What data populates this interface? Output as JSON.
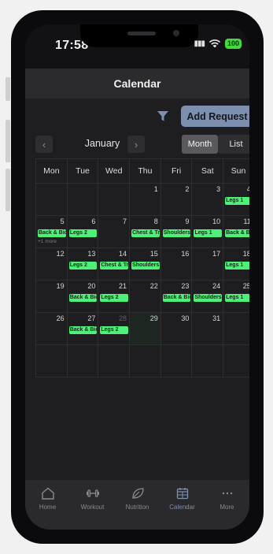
{
  "status": {
    "time": "17:58",
    "battery": "100"
  },
  "header": {
    "title": "Calendar"
  },
  "toolbar": {
    "add_request_label": "Add Request"
  },
  "calendar_nav": {
    "month": "January",
    "prev_icon": "chevron-left-icon",
    "next_icon": "chevron-right-icon"
  },
  "view_toggle": {
    "month_label": "Month",
    "list_label": "List",
    "selected": "Month"
  },
  "weekdays": [
    "Mon",
    "Tue",
    "Wed",
    "Thu",
    "Fri",
    "Sat",
    "Sun"
  ],
  "weeks": [
    [
      {
        "day": ""
      },
      {
        "day": ""
      },
      {
        "day": ""
      },
      {
        "day": "1"
      },
      {
        "day": "2"
      },
      {
        "day": "3"
      },
      {
        "day": "4",
        "events": [
          "Legs 1"
        ]
      }
    ],
    [
      {
        "day": "5",
        "events": [
          "Back & Biceps"
        ],
        "more": "+1 more"
      },
      {
        "day": "6",
        "events": [
          "Legs 2"
        ]
      },
      {
        "day": "7"
      },
      {
        "day": "8",
        "events": [
          "Chest & Triceps"
        ]
      },
      {
        "day": "9",
        "events": [
          "Shoulders"
        ]
      },
      {
        "day": "10",
        "events": [
          "Legs 1"
        ]
      },
      {
        "day": "11",
        "events": [
          "Back & Biceps"
        ]
      }
    ],
    [
      {
        "day": "12"
      },
      {
        "day": "13",
        "events": [
          "Legs 2"
        ]
      },
      {
        "day": "14",
        "events": [
          "Chest & Triceps"
        ]
      },
      {
        "day": "15",
        "events": [
          "Shoulders"
        ]
      },
      {
        "day": "16"
      },
      {
        "day": "17"
      },
      {
        "day": "18",
        "events": [
          "Legs 1"
        ]
      }
    ],
    [
      {
        "day": "19"
      },
      {
        "day": "20",
        "events": [
          "Back & Biceps"
        ]
      },
      {
        "day": "21",
        "events": [
          "Legs 2"
        ]
      },
      {
        "day": "22"
      },
      {
        "day": "23",
        "events": [
          "Back & Biceps"
        ]
      },
      {
        "day": "24",
        "events": [
          "Shoulders"
        ]
      },
      {
        "day": "25",
        "events": [
          "Legs 1"
        ]
      }
    ],
    [
      {
        "day": "26"
      },
      {
        "day": "27",
        "events": [
          "Back & Biceps"
        ]
      },
      {
        "day": "28",
        "faded": true,
        "events": [
          "Legs 2"
        ]
      },
      {
        "day": "29",
        "today": true
      },
      {
        "day": "30"
      },
      {
        "day": "31"
      },
      {
        "day": ""
      }
    ],
    [
      {
        "day": ""
      },
      {
        "day": ""
      },
      {
        "day": ""
      },
      {
        "day": ""
      },
      {
        "day": ""
      },
      {
        "day": ""
      },
      {
        "day": ""
      }
    ]
  ],
  "tabbar": {
    "items": [
      {
        "label": "Home",
        "icon": "home-icon"
      },
      {
        "label": "Workout",
        "icon": "dumbbell-icon"
      },
      {
        "label": "Nutrition",
        "icon": "leaf-icon"
      },
      {
        "label": "Calendar",
        "icon": "calendar-icon"
      },
      {
        "label": "More",
        "icon": "more-dots-icon"
      }
    ],
    "active": "Calendar"
  },
  "colors": {
    "accent": "#7d8fae",
    "event": "#4ff079",
    "background": "#1e1e20",
    "header": "#2b2b2d"
  }
}
